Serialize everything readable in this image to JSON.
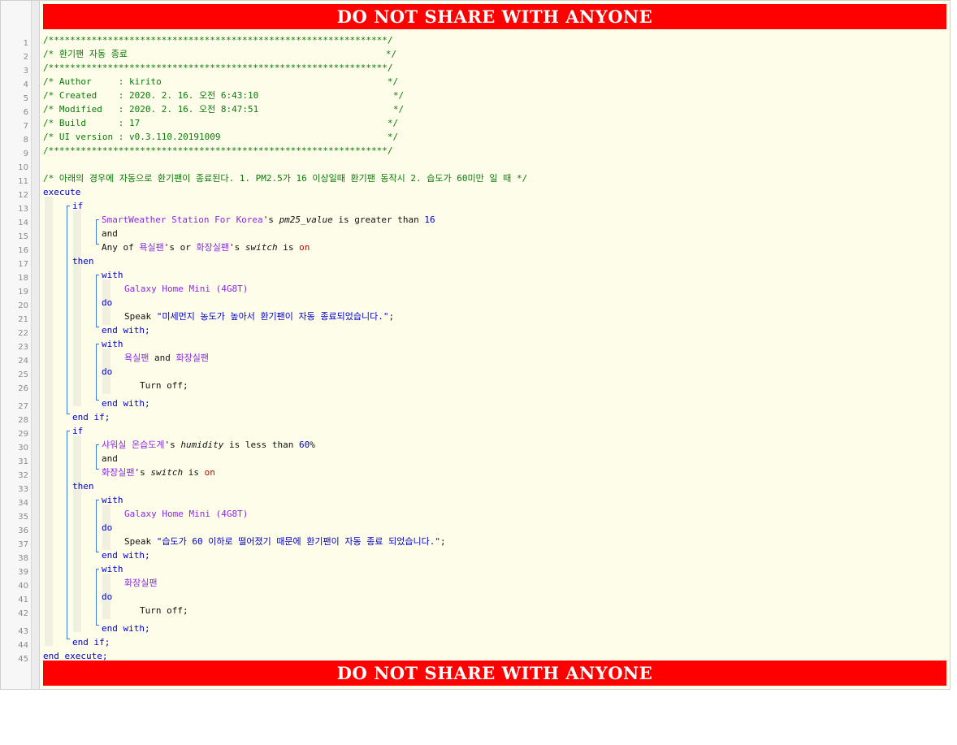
{
  "banner_text": "DO NOT SHARE WITH ANYONE",
  "lines": [
    {
      "n": "1",
      "indent": 0,
      "segs": [
        [
          "cm",
          "/***************************************************************/"
        ]
      ]
    },
    {
      "n": "2",
      "indent": 0,
      "segs": [
        [
          "cm",
          "/* 환기팬 자동 종료                                                */"
        ]
      ]
    },
    {
      "n": "3",
      "indent": 0,
      "segs": [
        [
          "cm",
          "/***************************************************************/"
        ]
      ]
    },
    {
      "n": "4",
      "indent": 0,
      "segs": [
        [
          "cm",
          "/* Author     : kirito                                          */"
        ]
      ]
    },
    {
      "n": "5",
      "indent": 0,
      "segs": [
        [
          "cm",
          "/* Created    : 2020. 2. 16. 오전 6:43:10                         */"
        ]
      ]
    },
    {
      "n": "6",
      "indent": 0,
      "segs": [
        [
          "cm",
          "/* Modified   : 2020. 2. 16. 오전 8:47:51                         */"
        ]
      ]
    },
    {
      "n": "7",
      "indent": 0,
      "segs": [
        [
          "cm",
          "/* Build      : 17                                              */"
        ]
      ]
    },
    {
      "n": "8",
      "indent": 0,
      "segs": [
        [
          "cm",
          "/* UI version : v0.3.110.20191009                               */"
        ]
      ]
    },
    {
      "n": "9",
      "indent": 0,
      "segs": [
        [
          "cm",
          "/***************************************************************/"
        ]
      ]
    },
    {
      "n": "10",
      "indent": 0,
      "segs": []
    },
    {
      "n": "11",
      "indent": 0,
      "segs": [
        [
          "cm",
          "/* 아래의 경우에 자동으로 환기팬이 종료된다. 1. PM2.5가 16 이상일때 환기팬 동작시 2. 습도가 60미만 일 때 */"
        ]
      ]
    },
    {
      "n": "12",
      "indent": 0,
      "segs": [
        [
          "kw",
          "execute"
        ]
      ]
    },
    {
      "n": "13",
      "indent": 1,
      "segs": [
        [
          "kw",
          "if"
        ]
      ]
    },
    {
      "n": "14",
      "indent": 2,
      "segs": [
        [
          "dev",
          "SmartWeather Station For Korea"
        ],
        [
          "",
          "'s "
        ],
        [
          "attr",
          "pm25_value"
        ],
        [
          "",
          " is greater than "
        ],
        [
          "num",
          "16"
        ]
      ]
    },
    {
      "n": "15",
      "indent": 2,
      "segs": [
        [
          "",
          "and"
        ]
      ]
    },
    {
      "n": "16",
      "indent": 2,
      "segs": [
        [
          "",
          "Any of "
        ],
        [
          "dev",
          "욕실팬"
        ],
        [
          "",
          "'s or "
        ],
        [
          "dev",
          "화장실팬"
        ],
        [
          "",
          "'s "
        ],
        [
          "attr",
          "switch"
        ],
        [
          "",
          " is "
        ],
        [
          "on",
          "on"
        ]
      ]
    },
    {
      "n": "17",
      "indent": 1,
      "segs": [
        [
          "kw",
          "then"
        ]
      ]
    },
    {
      "n": "18",
      "indent": 2,
      "segs": [
        [
          "kw",
          "with"
        ]
      ]
    },
    {
      "n": "19",
      "indent": 3,
      "segs": [
        [
          "dev",
          "Galaxy Home Mini (4G8T)"
        ]
      ]
    },
    {
      "n": "20",
      "indent": 2,
      "segs": [
        [
          "kw",
          "do"
        ]
      ]
    },
    {
      "n": "21",
      "indent": 3,
      "segs": [
        [
          "",
          "Speak "
        ],
        [
          "str",
          "\"미세먼지 농도가 높아서 환기팬이 자동 종료되었습니다.\""
        ],
        [
          "",
          ";"
        ]
      ]
    },
    {
      "n": "22",
      "indent": 2,
      "segs": [
        [
          "kw",
          "end with;"
        ]
      ]
    },
    {
      "n": "23",
      "indent": 2,
      "segs": [
        [
          "kw",
          "with"
        ]
      ]
    },
    {
      "n": "24",
      "indent": 3,
      "segs": [
        [
          "dev",
          "욕실팬"
        ],
        [
          "",
          " and "
        ],
        [
          "dev",
          "화장실팬"
        ]
      ]
    },
    {
      "n": "25",
      "indent": 2,
      "segs": [
        [
          "kw",
          "do"
        ]
      ]
    },
    {
      "n": "26",
      "indent": 4,
      "segs": [
        [
          "",
          "Turn off;"
        ]
      ]
    },
    {
      "n": "27",
      "indent": 2,
      "segs": [
        [
          "kw",
          "end with;"
        ]
      ]
    },
    {
      "n": "28",
      "indent": 1,
      "segs": [
        [
          "kw",
          "end if;"
        ]
      ]
    },
    {
      "n": "29",
      "indent": 1,
      "segs": [
        [
          "kw",
          "if"
        ]
      ]
    },
    {
      "n": "30",
      "indent": 2,
      "segs": [
        [
          "dev",
          "샤워실 온습도계"
        ],
        [
          "",
          "'s "
        ],
        [
          "attr",
          "humidity"
        ],
        [
          "",
          " is less than "
        ],
        [
          "num",
          "60"
        ],
        [
          "",
          "%"
        ]
      ]
    },
    {
      "n": "31",
      "indent": 2,
      "segs": [
        [
          "",
          "and"
        ]
      ]
    },
    {
      "n": "32",
      "indent": 2,
      "segs": [
        [
          "dev",
          "화장실팬"
        ],
        [
          "",
          "'s "
        ],
        [
          "attr",
          "switch"
        ],
        [
          "",
          " is "
        ],
        [
          "on",
          "on"
        ]
      ]
    },
    {
      "n": "33",
      "indent": 1,
      "segs": [
        [
          "kw",
          "then"
        ]
      ]
    },
    {
      "n": "34",
      "indent": 2,
      "segs": [
        [
          "kw",
          "with"
        ]
      ]
    },
    {
      "n": "35",
      "indent": 3,
      "segs": [
        [
          "dev",
          "Galaxy Home Mini (4G8T)"
        ]
      ]
    },
    {
      "n": "36",
      "indent": 2,
      "segs": [
        [
          "kw",
          "do"
        ]
      ]
    },
    {
      "n": "37",
      "indent": 3,
      "segs": [
        [
          "",
          "Speak "
        ],
        [
          "str",
          "\"습도가 60 이하로 떨어졌기 때문에 환기팬이 자동 종료 되었습니다.\""
        ],
        [
          "",
          ";"
        ]
      ]
    },
    {
      "n": "38",
      "indent": 2,
      "segs": [
        [
          "kw",
          "end with;"
        ]
      ]
    },
    {
      "n": "39",
      "indent": 2,
      "segs": [
        [
          "kw",
          "with"
        ]
      ]
    },
    {
      "n": "40",
      "indent": 3,
      "segs": [
        [
          "dev",
          "화장실팬"
        ]
      ]
    },
    {
      "n": "41",
      "indent": 2,
      "segs": [
        [
          "kw",
          "do"
        ]
      ]
    },
    {
      "n": "42",
      "indent": 4,
      "segs": [
        [
          "",
          "Turn off;"
        ]
      ]
    },
    {
      "n": "43",
      "indent": 2,
      "segs": [
        [
          "kw",
          "end with;"
        ]
      ]
    },
    {
      "n": "44",
      "indent": 1,
      "segs": [
        [
          "kw",
          "end if;"
        ]
      ]
    },
    {
      "n": "45",
      "indent": 0,
      "segs": [
        [
          "kw",
          "end execute;"
        ]
      ]
    }
  ]
}
